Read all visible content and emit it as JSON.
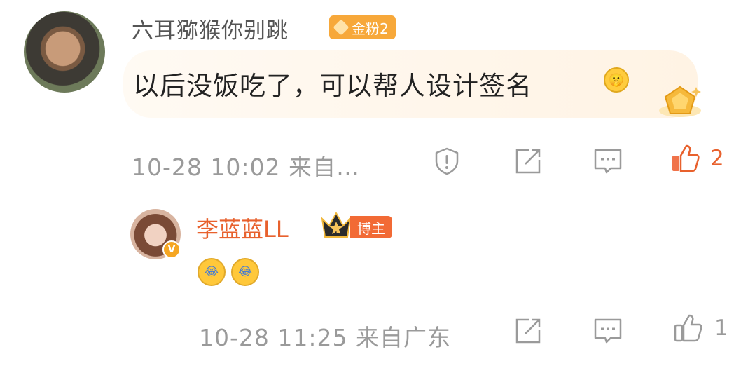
{
  "comment": {
    "user": "六耳猕猴你别跳",
    "badge": "金粉2",
    "text": "以后没饭吃了，可以帮人设计签名",
    "emoji_icon": "shush-emoji-icon",
    "time": "10-28 10:02",
    "source": "来自…",
    "likes": "2",
    "liked": true,
    "accent_color": "#e8612d"
  },
  "reply": {
    "user": "李蓝蓝LL",
    "verified_badge": "V",
    "crown_level": "II",
    "badge": "博主",
    "emojis": [
      "laugh-cry-emoji-icon",
      "laugh-cry-emoji-icon"
    ],
    "time": "10-28 11:25",
    "source": "来自广东",
    "likes": "1",
    "liked": false
  }
}
